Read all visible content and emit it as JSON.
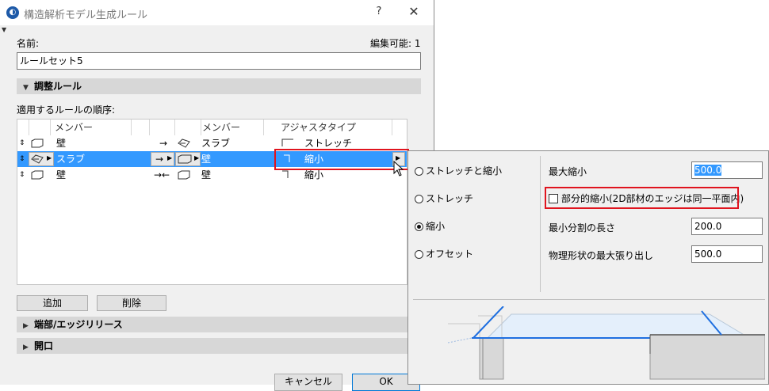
{
  "window": {
    "title": "構造解析モデル生成ルール",
    "help_label": "?",
    "close_label": "✕"
  },
  "name_label": "名前:",
  "editable_label": "編集可能: 1",
  "name_value": "ルールセット5",
  "adjust_section": {
    "label": "調整ルール",
    "expanded": true
  },
  "order_label": "適用するルールの順序:",
  "table": {
    "headers": {
      "member1": "メンバー",
      "member2": "メンバー",
      "type": "アジャスタタイプ"
    },
    "rows": [
      {
        "member1": "壁",
        "arrow": "→",
        "member2": "スラブ",
        "type": "ストレッチ",
        "selected": false
      },
      {
        "member1": "スラブ",
        "arrow": "→",
        "member2": "壁",
        "type": "縮小",
        "selected": true
      },
      {
        "member1": "壁",
        "arrow": "→←",
        "member2": "壁",
        "type": "縮小",
        "selected": false
      }
    ]
  },
  "add_button": "追加",
  "delete_button": "削除",
  "edge_section": {
    "label": "端部/エッジリリース",
    "expanded": false
  },
  "opening_section": {
    "label": "開口",
    "expanded": false
  },
  "cancel_button": "キャンセル",
  "ok_button": "OK",
  "popup": {
    "options": [
      {
        "label": "ストレッチと縮小",
        "selected": false
      },
      {
        "label": "ストレッチ",
        "selected": false
      },
      {
        "label": "縮小",
        "selected": true
      },
      {
        "label": "オフセット",
        "selected": false
      }
    ],
    "max_shrink_label": "最大縮小",
    "max_shrink_value": "500.0",
    "partial_shrink_label": "部分的縮小(2D部材のエッジは同一平面内)",
    "partial_shrink_checked": false,
    "min_split_label": "最小分割の長さ",
    "min_split_value": "200.0",
    "max_protrusion_label": "物理形状の最大張り出し",
    "max_protrusion_value": "500.0"
  },
  "colors": {
    "selection": "#3399ff",
    "highlight_box": "#e0141e",
    "diagram_line": "#1f6fe0"
  }
}
